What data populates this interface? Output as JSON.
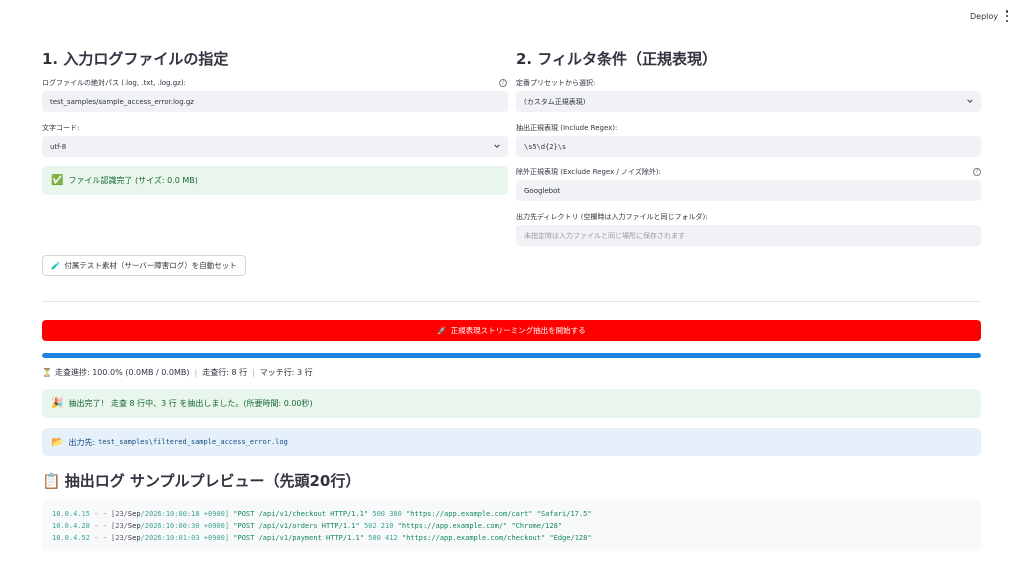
{
  "header": {
    "deploy_label": "Deploy"
  },
  "left": {
    "title": "1. 入力ログファイルの指定",
    "path_label": "ログファイルの絶対パス (.log, .txt, .log.gz):",
    "path_value": "test_samples/sample_access_error.log.gz",
    "encoding_label": "文字コード:",
    "encoding_value": "utf-8",
    "recognized_icon": "✅",
    "recognized_text": "ファイル認識完了 (サイズ: 0.0 MB)",
    "sample_button_icon": "🧪",
    "sample_button_label": "付属テスト素材（サーバー障害ログ）を自動セット"
  },
  "right": {
    "title": "2. フィルタ条件（正規表現）",
    "preset_label": "定番プリセットから選択:",
    "preset_value": "(カスタム正規表現)",
    "include_label": "抽出正規表現 (Include Regex):",
    "include_value": "\\s5\\d{2}\\s",
    "exclude_label": "除外正規表現 (Exclude Regex / ノイズ除外):",
    "exclude_value": "Googlebot",
    "output_label": "出力先ディレクトリ (空欄時は入力ファイルと同じフォルダ):",
    "output_placeholder": "未指定時は入力ファイルと同じ場所に保存されます"
  },
  "run": {
    "icon": "🚀",
    "label": "正規表現ストリーミング抽出を開始する",
    "progress": 1.0
  },
  "stats": {
    "icon": "⏳",
    "progress_text": "走査進捗: 100.0% (0.0MB / 0.0MB)",
    "separator": "|",
    "scanned_text": "走査行: 8 行",
    "matched_text": "マッチ行: 3 行"
  },
  "result": {
    "icon": "🎉",
    "text": "抽出完了！ 走査 8 行中、3 行 を抽出しました。(所要時間: 0.00秒)",
    "output_icon": "📂",
    "output_label": "出力先:",
    "output_path": "test_samples\\filtered_sample_access_error.log"
  },
  "preview": {
    "icon": "📋",
    "title": "抽出ログ サンプルプレビュー（先頭20行）",
    "lines": [
      {
        "ip": "10.0.4.15",
        "dash": "- -",
        "date_a": "[23/",
        "month": "Sep",
        "date_b": "/2026:10:00:18 +0900]",
        "request": "\"POST /api/v1/checkout HTTP/1.1\"",
        "nums": "500 380",
        "referer": "\"https://app.example.com/cart\"",
        "ua": "\"Safari/17.5\""
      },
      {
        "ip": "10.0.4.28",
        "dash": "- -",
        "date_a": "[23/",
        "month": "Sep",
        "date_b": "/2026:10:00:30 +0900]",
        "request": "\"POST /api/v1/orders HTTP/1.1\"",
        "nums": "502 210",
        "referer": "\"https://app.example.com/\"",
        "ua": "\"Chrome/128\""
      },
      {
        "ip": "10.0.4.52",
        "dash": "- -",
        "date_a": "[23/",
        "month": "Sep",
        "date_b": "/2026:10:01:03 +0900]",
        "request": "\"POST /api/v1/payment HTTP/1.1\"",
        "nums": "500 412",
        "referer": "\"https://app.example.com/checkout\"",
        "ua": "\"Edge/128\""
      }
    ]
  }
}
